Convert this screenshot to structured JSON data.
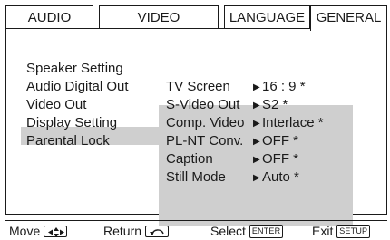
{
  "tabs": [
    {
      "label": "AUDIO",
      "active": false
    },
    {
      "label": "VIDEO",
      "active": false
    },
    {
      "label": "LANGUAGE",
      "active": false
    },
    {
      "label": "GENERAL",
      "active": true
    }
  ],
  "menu": {
    "items": [
      {
        "label": "Speaker Setting"
      },
      {
        "label": "Audio Digital Out"
      },
      {
        "label": "Video Out",
        "selected": true
      },
      {
        "label": "Display Setting"
      },
      {
        "label": "Parental Lock"
      }
    ]
  },
  "submenu": {
    "rows": [
      {
        "label": "TV Screen",
        "value": "16 : 9 *"
      },
      {
        "label": "S-Video Out",
        "value": "S2 *"
      },
      {
        "label": "Comp. Video",
        "value": "Interlace *"
      },
      {
        "label": "PL-NT Conv.",
        "value": "OFF *"
      },
      {
        "label": "Caption",
        "value": "OFF *"
      },
      {
        "label": "Still Mode",
        "value": "Auto *"
      }
    ],
    "arrow_glyph": "▶"
  },
  "hints": {
    "move": {
      "label": "Move",
      "icon": "four-way-arrow-icon"
    },
    "return": {
      "label": "Return",
      "icon": "return-arrow-icon"
    },
    "select": {
      "label": "Select",
      "key": "ENTER"
    },
    "exit": {
      "label": "Exit",
      "key": "SETUP"
    }
  },
  "colors": {
    "highlight": "#cfcfcf",
    "border": "#1a1a1a",
    "background": "#ffffff"
  }
}
